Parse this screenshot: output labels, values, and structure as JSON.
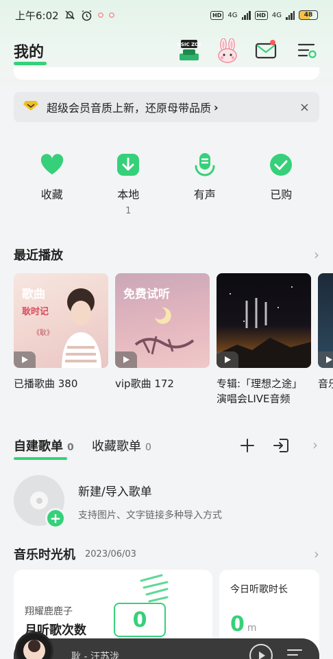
{
  "status_bar": {
    "time": "上午6:02",
    "network_1": "4G",
    "network_2": "4G",
    "hd_1": "HD",
    "hd_2": "HD",
    "battery": "48"
  },
  "header": {
    "title": "我的",
    "music_zone_badge": "MUSIC ZONE"
  },
  "banner": {
    "text": "超级会员音质上新，还原母带品质",
    "chevron": "›",
    "close": "×"
  },
  "quick_actions": [
    {
      "label": "收藏",
      "count": "",
      "icon": "heart-icon"
    },
    {
      "label": "本地",
      "count": "1",
      "icon": "download-icon"
    },
    {
      "label": "有声",
      "count": "",
      "icon": "microphone-icon"
    },
    {
      "label": "已购",
      "count": "",
      "icon": "check-icon"
    }
  ],
  "recent": {
    "title": "最近播放",
    "cards": [
      {
        "tag": "歌曲",
        "caption": "已播歌曲 380"
      },
      {
        "tag": "免费试听",
        "caption": "vip歌曲 172"
      },
      {
        "tag": "",
        "caption": "专辑:「理想之途」演唱会LIVE音频"
      },
      {
        "tag": "",
        "caption": "音乐"
      }
    ]
  },
  "playlists": {
    "tab_created": "自建歌单",
    "tab_created_count": "0",
    "tab_collected": "收藏歌单",
    "tab_collected_count": "0",
    "new_title": "新建/导入歌单",
    "new_subtitle": "支持图片、文字链接多种导入方式"
  },
  "time_machine": {
    "title": "音乐时光机",
    "date": "2023/06/03",
    "username": "翔耀鹿鹿子",
    "monthly_label": "月听歌次数",
    "monthly_value": "0",
    "today_label": "今日听歌时长",
    "today_value": "0",
    "today_unit": "m"
  },
  "player": {
    "text": "耿 - 汪苏泷"
  },
  "colors": {
    "accent": "#36d07a",
    "background": "#f3f4f5"
  }
}
